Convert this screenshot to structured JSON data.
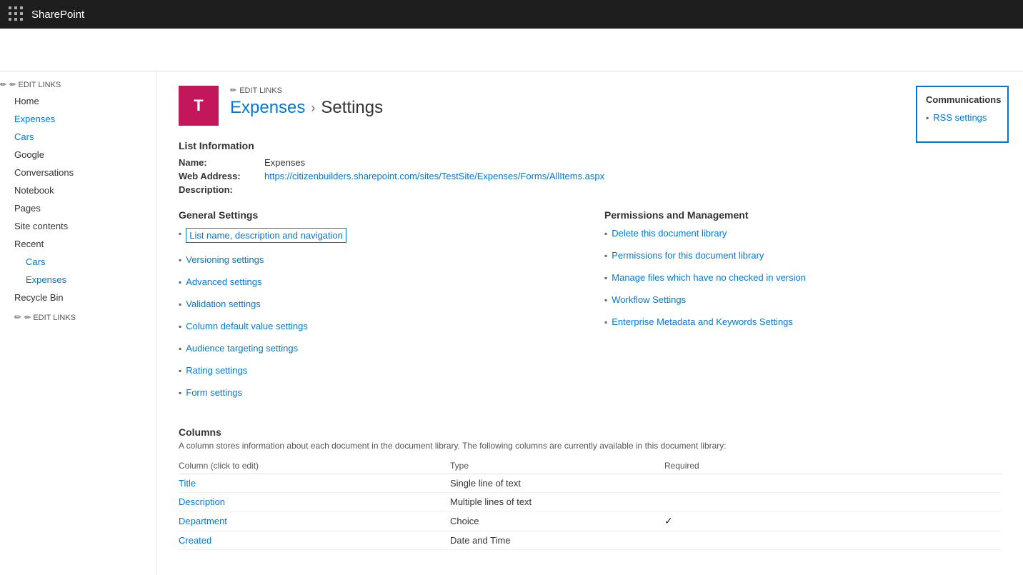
{
  "topbar": {
    "app_name": "SharePoint"
  },
  "header": {
    "edit_links_label": "✏ EDIT LINKS",
    "site_icon_letter": "T",
    "breadcrumb_home": "Expenses",
    "breadcrumb_separator": "›",
    "breadcrumb_current": "Settings"
  },
  "sidebar": {
    "items": [
      {
        "label": "Home",
        "level": "top",
        "link": true
      },
      {
        "label": "Expenses",
        "level": "top",
        "link": true
      },
      {
        "label": "Cars",
        "level": "top",
        "link": true
      },
      {
        "label": "Google",
        "level": "top",
        "link": false
      },
      {
        "label": "Conversations",
        "level": "top",
        "link": false
      },
      {
        "label": "Notebook",
        "level": "top",
        "link": false
      },
      {
        "label": "Pages",
        "level": "top",
        "link": false
      },
      {
        "label": "Site contents",
        "level": "top",
        "link": false
      },
      {
        "label": "Recent",
        "level": "top",
        "link": false
      },
      {
        "label": "Cars",
        "level": "sub",
        "link": true
      },
      {
        "label": "Expenses",
        "level": "sub",
        "link": true
      },
      {
        "label": "Recycle Bin",
        "level": "top",
        "link": false
      }
    ],
    "edit_links_label": "✏ EDIT LINKS"
  },
  "list_info": {
    "section_title": "List Information",
    "name_label": "Name:",
    "name_value": "Expenses",
    "web_address_label": "Web Address:",
    "web_address_value": "https://citizenbuilders.sharepoint.com/sites/TestSite/Expenses/Forms/AllItems.aspx",
    "description_label": "Description:"
  },
  "general_settings": {
    "title": "General Settings",
    "links": [
      {
        "label": "List name, description and navigation",
        "focused": true
      },
      {
        "label": "Versioning settings",
        "focused": false
      },
      {
        "label": "Advanced settings",
        "focused": false
      },
      {
        "label": "Validation settings",
        "focused": false
      },
      {
        "label": "Column default value settings",
        "focused": false
      },
      {
        "label": "Audience targeting settings",
        "focused": false
      },
      {
        "label": "Rating settings",
        "focused": false
      },
      {
        "label": "Form settings",
        "focused": false
      }
    ]
  },
  "permissions_management": {
    "title": "Permissions and Management",
    "links": [
      {
        "label": "Delete this document library"
      },
      {
        "label": "Permissions for this document library"
      },
      {
        "label": "Manage files which have no checked in version"
      },
      {
        "label": "Workflow Settings"
      },
      {
        "label": "Enterprise Metadata and Keywords Settings"
      }
    ]
  },
  "communications": {
    "title": "Communications",
    "links": [
      {
        "label": "RSS settings"
      }
    ]
  },
  "columns": {
    "section_title": "Columns",
    "description": "A column stores information about each document in the document library. The following columns are currently available in this document library:",
    "header_column": "Column (click to edit)",
    "header_type": "Type",
    "header_required": "Required",
    "rows": [
      {
        "column": "Title",
        "type": "Single line of text",
        "required": false
      },
      {
        "column": "Description",
        "type": "Multiple lines of text",
        "required": false
      },
      {
        "column": "Department",
        "type": "Choice",
        "required": true
      },
      {
        "column": "Created",
        "type": "Date and Time",
        "required": false
      }
    ]
  }
}
